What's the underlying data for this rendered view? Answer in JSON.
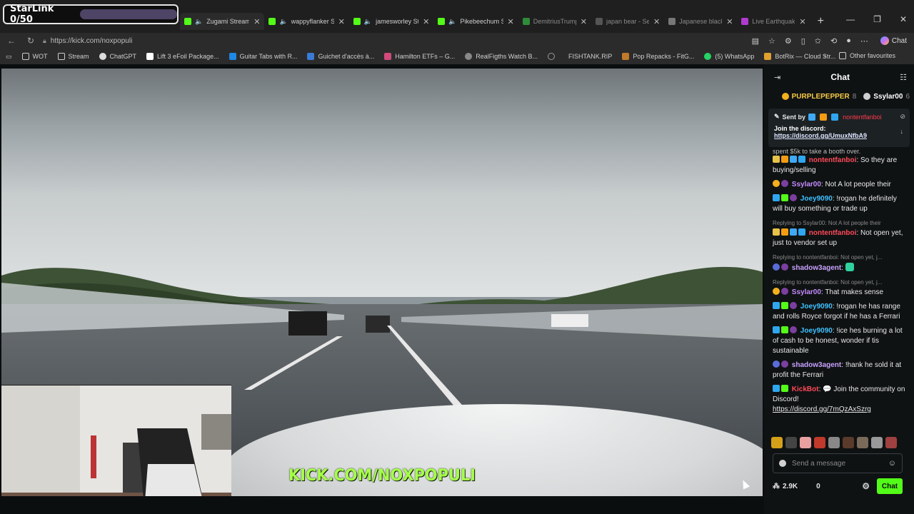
{
  "starlink": {
    "label": "StarLink 0/50"
  },
  "tabs": [
    {
      "label": "Zugami Stream",
      "fav_color": "#53fc18",
      "audio": true,
      "active": true
    },
    {
      "label": "wappyflanker St",
      "fav_color": "#53fc18",
      "audio": true
    },
    {
      "label": "jamesworley St",
      "fav_color": "#53fc18",
      "audio": true
    },
    {
      "label": "Pikebeechum St",
      "fav_color": "#53fc18",
      "audio": true
    },
    {
      "label": "DemitriusTrump Stre",
      "fav_color": "#2e8b3a",
      "audio": false,
      "dim": true
    },
    {
      "label": "japan bear - Search",
      "fav_color": "#555555",
      "audio": false,
      "dim": true
    },
    {
      "label": "Japanese black bear",
      "fav_color": "#777777",
      "audio": false,
      "dim": true
    },
    {
      "label": "Live Earthquake Trac",
      "fav_color": "#b03ad0",
      "audio": false,
      "dim": true
    }
  ],
  "address": {
    "url": "https://kick.com/noxpopuli"
  },
  "copilot": {
    "label": "Chat"
  },
  "bookmarks": [
    {
      "label": "WOT",
      "color": "#cccccc"
    },
    {
      "label": "Stream",
      "color": "#cccccc"
    },
    {
      "label": "ChatGPT",
      "color": "#dddddd"
    },
    {
      "label": "Lift 3 eFoil Package...",
      "color": "#ffffff"
    },
    {
      "label": "Guitar Tabs with R...",
      "color": "#1e88e5"
    },
    {
      "label": "Guichet d'accès à...",
      "color": "#3a7bd5"
    },
    {
      "label": "Hamilton ETFs – G...",
      "color": "#d04a7a"
    },
    {
      "label": "RealFigths Watch B...",
      "color": "#888888"
    },
    {
      "label": "",
      "color": "#999999"
    },
    {
      "label": "FISHTANK.RIP",
      "color": "#cc2222"
    },
    {
      "label": "Pop Repacks - FitG...",
      "color": "#c07a2a"
    },
    {
      "label": "(5) WhatsApp",
      "color": "#25d366"
    },
    {
      "label": "BotRix — Cloud Str...",
      "color": "#e0a030"
    }
  ],
  "bookmarks_right": {
    "other": "Other favourites"
  },
  "player": {
    "overlay_text": "KICK.COM/NOXPOPULI"
  },
  "chat": {
    "title": "Chat",
    "leaders": [
      {
        "name": "PURPLEPEPPER",
        "count": "8",
        "color": "#f7c94a",
        "coin": "#f2b01e"
      },
      {
        "name": "Ssylar00",
        "count": "6",
        "color": "#ffffff",
        "coin": "#cfcfcf"
      }
    ],
    "pinned": {
      "sent_by": "Sent by",
      "sender": "nontentfanboi",
      "text": "Join the discord:",
      "link": "https://discord.gg/UmuxNfbA9"
    },
    "truncated_top": "spent $5k to take a booth over.",
    "messages": [
      {
        "badges": [
          "#e6c24a",
          "#f39c12",
          "#3fa9f5",
          "#2fa6f0"
        ],
        "user": "nontentfanboi",
        "color": "#ff4a5a",
        "text": "So they are buying/selling"
      },
      {
        "badges": [
          "#f2b01e",
          "#7b3fa0"
        ],
        "user": "Ssylar00",
        "color": "#c48bff",
        "text": "Not A lot people their"
      },
      {
        "badges": [
          "#2fa6f0",
          "#53fc18",
          "#7b3fa0"
        ],
        "user": "Joey9090",
        "color": "#3ec1ff",
        "text": "!rogan he definitely will buy something or trade up"
      },
      {
        "reply": "Replying to Ssylar00: Not A lot people their",
        "badges": [
          "#e6c24a",
          "#f39c12",
          "#3fa9f5",
          "#2fa6f0"
        ],
        "user": "nontentfanboi",
        "color": "#ff4a5a",
        "text": "Not open yet, just to vendor set up"
      },
      {
        "reply": "Replying to nontentfanboi: Not open yet, j...",
        "badges": [
          "#5a6cd8",
          "#7b3fa0"
        ],
        "user": "shadow3agent",
        "color": "#c8a2ff",
        "text": ""
      },
      {
        "reply": "Replying to nontentfanboi: Not open yet, j...",
        "badges": [
          "#f2b01e",
          "#7b3fa0"
        ],
        "user": "Ssylar00",
        "color": "#c48bff",
        "text": "That makes sense"
      },
      {
        "badges": [
          "#2fa6f0",
          "#53fc18",
          "#7b3fa0"
        ],
        "user": "Joey9090",
        "color": "#3ec1ff",
        "text": "!rogan he has range and rolls Royce forgot if he has a Ferrari"
      },
      {
        "badges": [
          "#2fa6f0",
          "#53fc18",
          "#7b3fa0"
        ],
        "user": "Joey9090",
        "color": "#3ec1ff",
        "text": "!ice hes burning a lot of cash to be honest, wonder if tis sustainable"
      },
      {
        "badges": [
          "#5a6cd8",
          "#7b3fa0"
        ],
        "user": "shadow3agent",
        "color": "#c8a2ff",
        "text": "!hank he sold it at profit the Ferrari"
      },
      {
        "badges": [
          "#2fa6f0",
          "#53fc18"
        ],
        "user": "KickBot",
        "color": "#ff4a5a",
        "text": "💬 Join the community on Discord!",
        "link": "https://discord.gg/7mQzAxSzrg"
      }
    ],
    "input_placeholder": "Send a message",
    "viewers": "2.9K",
    "points": "0",
    "chat_button": "Chat"
  }
}
